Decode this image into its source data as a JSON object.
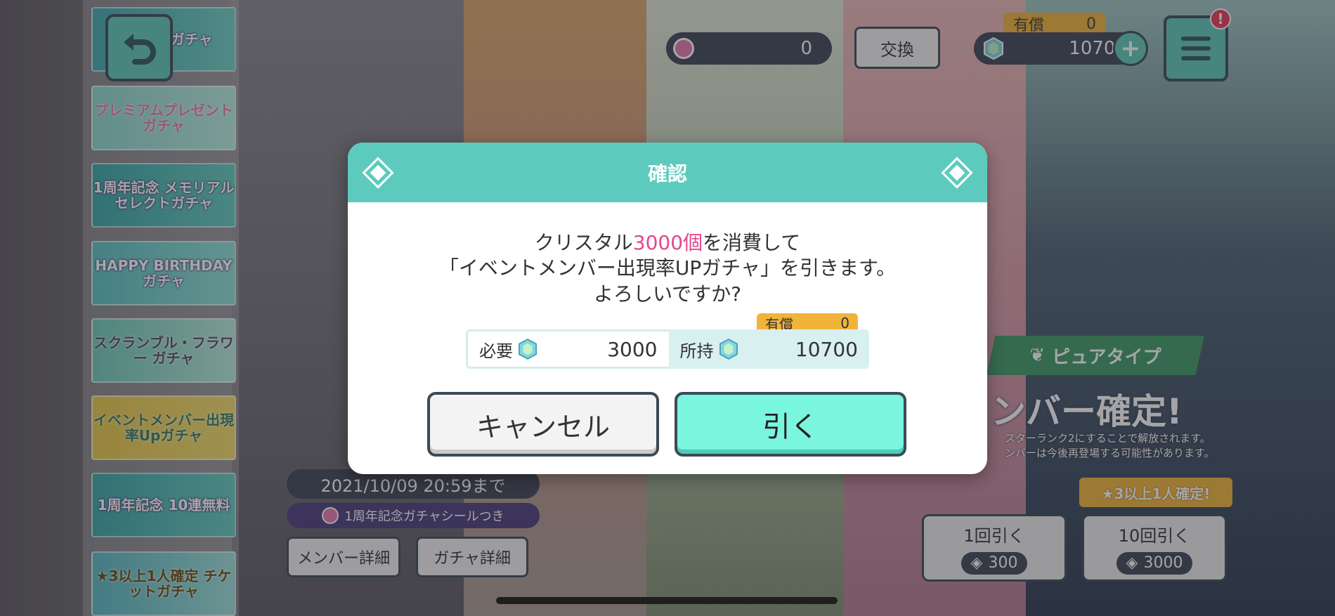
{
  "topbar": {
    "coin_value": "0",
    "exchange_label": "交換",
    "paid_label": "有償",
    "paid_value": "0",
    "crystal_value": "10700",
    "plus_label": "+",
    "notice_badge": "!"
  },
  "banners": [
    "チャンスガチャ",
    "プレミアムプレゼントガチャ",
    "1周年記念 メモリアルセレクトガチャ",
    "HAPPY BIRTHDAY ガチャ",
    "スクランブル・フラワー ガチャ",
    "イベントメンバー出現率Upガチャ",
    "1周年記念 10連無料",
    "★3以上1人確定 チケットガチャ"
  ],
  "gacha": {
    "period": "2021/10/09 20:59まで",
    "sticker_note": "1周年記念ガチャシールつき",
    "member_detail_button": "メンバー詳細",
    "gacha_detail_button": "ガチャ詳細",
    "type_tag": "ピュアタイプ",
    "confirm_banner": "ンバー確定!",
    "unlock_note_1": "スターランク2にすることで解放されます。",
    "unlock_note_2": "ンバーは今後再登場する可能性があります。",
    "guarantee_tag": "★3以上1人確定!",
    "pull_single_label": "1回引く",
    "pull_single_cost": "300",
    "pull_ten_label": "10回引く",
    "pull_ten_cost": "3000"
  },
  "modal": {
    "title": "確認",
    "line1_pre": "クリスタル",
    "line1_highlight": "3000個",
    "line1_post": "を消費して",
    "line2": "「イベントメンバー出現率UPガチャ」を引きます。",
    "line3": "よろしいですか?",
    "need_label": "必要",
    "need_value": "3000",
    "owned_label": "所持",
    "owned_value": "10700",
    "paid_label": "有償",
    "paid_value": "0",
    "cancel_label": "キャンセル",
    "draw_label": "引く"
  },
  "colors": {
    "accent_teal": "#5ccbbd",
    "draw_button": "#7af5de",
    "highlight_pink": "#e5468e",
    "paid_orange": "#f0b43a",
    "dark_pill": "#3e4456"
  }
}
